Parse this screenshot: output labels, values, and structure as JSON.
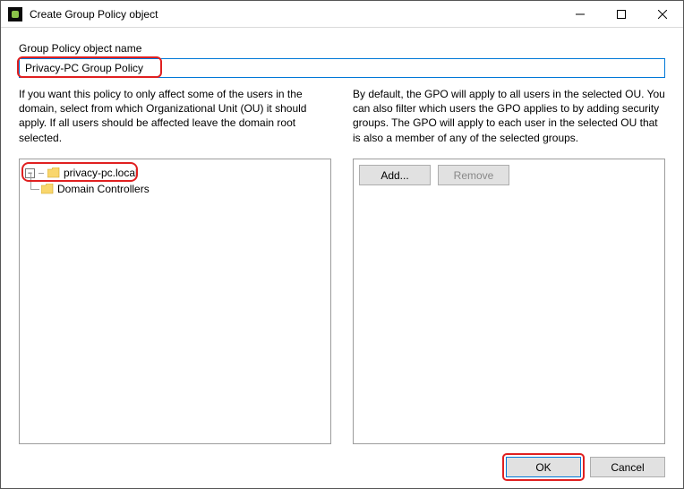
{
  "window": {
    "title": "Create Group Policy object"
  },
  "form": {
    "name_label": "Group Policy object name",
    "name_value": "Privacy-PC Group Policy"
  },
  "left": {
    "description": "If you want this policy to only affect some of the users in the domain, select from which Organizational Unit (OU) it should apply. If all users should be affected leave the domain root selected.",
    "tree": {
      "root": "privacy-pc.local",
      "child": "Domain Controllers"
    }
  },
  "right": {
    "description": "By default, the GPO will apply to all users in the selected OU. You can also filter which users the GPO applies to by adding security groups. The GPO will apply to each user in the selected OU that is also a member of any of the selected groups.",
    "add_label": "Add...",
    "remove_label": "Remove"
  },
  "footer": {
    "ok_label": "OK",
    "cancel_label": "Cancel"
  }
}
